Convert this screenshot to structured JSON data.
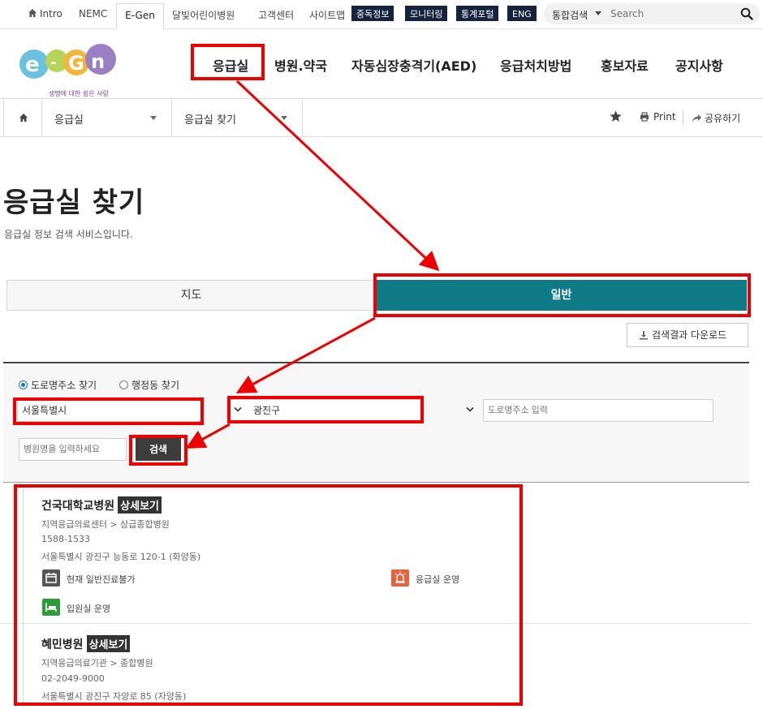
{
  "topbar": {
    "intro": "Intro",
    "nemc": "NEMC",
    "egen": "E-Gen",
    "moonlight": "달빛어린이병원",
    "customer": "고객센터",
    "sitemap": "사이트맵",
    "pills": [
      "중독정보",
      "모니터링",
      "통계포털",
      "ENG"
    ],
    "search_type": "통합검색",
    "search_placeholder": "Search"
  },
  "logo": {
    "tagline": "생명에 대한 쉼은 사랑"
  },
  "gnb": [
    "응급실",
    "병원.약국",
    "자동심장충격기(AED)",
    "응급처치방법",
    "홍보자료",
    "공지사항"
  ],
  "location": {
    "level1": "응급실",
    "level2": "응급실 찾기",
    "print": "Print",
    "share": "공유하기"
  },
  "page": {
    "title": "응급실 찾기",
    "description": "응급실 정보 검색 서비스입니다."
  },
  "tabs": {
    "map": "지도",
    "general": "일반"
  },
  "download_label": "검색결과 다운로드",
  "search": {
    "radio_road": "도로명주소 찾기",
    "radio_dong": "행정동 찾기",
    "city": "서울특별시",
    "district": "광진구",
    "road_placeholder": "도로명주소 입력",
    "hospital_placeholder": "병원명을 입력하세요",
    "button": "검색"
  },
  "results": [
    {
      "name": "건국대학교병원",
      "detail_label": "상세보기",
      "type": "지역응급의료센터 > 상급종합병원",
      "phone": "1588-1533",
      "address": "서울특별시 광진구 능동로 120-1 (화양동)",
      "status": [
        {
          "label": "현재 일반진료불가",
          "icon": "calendar-icon",
          "color": "#555555"
        },
        {
          "label": "응급실 운영",
          "icon": "siren-icon",
          "color": "#e8613c"
        },
        {
          "label": "입원실 운영",
          "icon": "bed-icon",
          "color": "#2e9b3a"
        }
      ]
    },
    {
      "name": "혜민병원",
      "detail_label": "상세보기",
      "type": "지역응급의료기관 > 종합병원",
      "phone": "02-2049-9000",
      "address": "서울특별시 광진구 자양로 85 (자양동)"
    }
  ],
  "colors": {
    "accent": "#0e7a86",
    "annotation": "#ee0000",
    "pill": "#16233f"
  }
}
